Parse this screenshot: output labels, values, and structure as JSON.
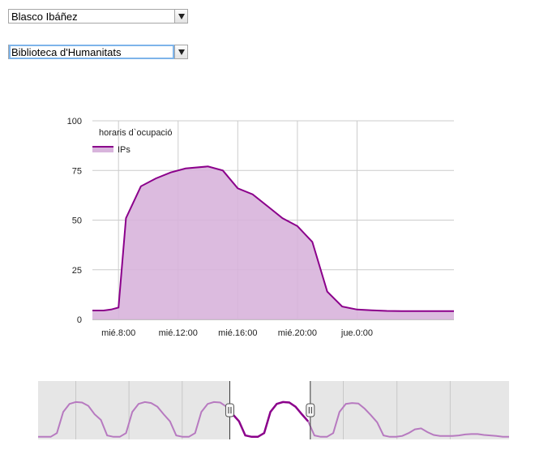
{
  "filters": {
    "campus": {
      "selected": "Blasco Ibáñez"
    },
    "library": {
      "selected": "Biblioteca d'Humanitats"
    }
  },
  "colors": {
    "series_line": "#8b008b",
    "series_fill": "#d8b4dc",
    "grid": "#cccccc",
    "navigator_bg": "#e6e6e6",
    "navigator_line": "#b77ac0"
  },
  "chart_data": {
    "type": "area",
    "legend_title": "horaris d`ocupació",
    "legend_position": "top-left",
    "grid": true,
    "ylim": [
      0,
      100
    ],
    "yticks": [
      "0",
      "25",
      "50",
      "75",
      "100"
    ],
    "xlim": [
      6.25,
      30.5
    ],
    "xticks": [
      {
        "label": "mié.8:00",
        "x": 8
      },
      {
        "label": "mié.12:00",
        "x": 12
      },
      {
        "label": "mié.16:00",
        "x": 16
      },
      {
        "label": "mié.20:00",
        "x": 20
      },
      {
        "label": "jue.0:00",
        "x": 24
      }
    ],
    "series": [
      {
        "name": "IPs",
        "x": [
          6.25,
          7,
          7.5,
          8,
          8.5,
          9.5,
          10.5,
          11.5,
          12.5,
          14,
          15,
          16,
          17,
          18,
          19,
          20,
          21,
          22,
          23,
          24,
          25,
          26,
          27,
          28,
          30.5
        ],
        "values": [
          4.5,
          4.5,
          5,
          6,
          51,
          67,
          71,
          74,
          76,
          77,
          75,
          66,
          63,
          57,
          51,
          47,
          39,
          14,
          6.5,
          5,
          4.6,
          4.3,
          4.2,
          4.2,
          4.2
        ]
      }
    ]
  },
  "navigator": {
    "range_start": 0.407,
    "range_end": 0.578,
    "values": [
      0.02,
      0.02,
      0.02,
      0.1,
      0.55,
      0.72,
      0.76,
      0.75,
      0.68,
      0.5,
      0.38,
      0.05,
      0.02,
      0.02,
      0.1,
      0.55,
      0.72,
      0.76,
      0.74,
      0.66,
      0.5,
      0.35,
      0.05,
      0.02,
      0.02,
      0.1,
      0.55,
      0.72,
      0.76,
      0.75,
      0.66,
      0.5,
      0.35,
      0.05,
      0.02,
      0.02,
      0.1,
      0.55,
      0.72,
      0.76,
      0.75,
      0.66,
      0.5,
      0.35,
      0.05,
      0.02,
      0.02,
      0.1,
      0.55,
      0.72,
      0.74,
      0.73,
      0.62,
      0.48,
      0.33,
      0.05,
      0.02,
      0.02,
      0.04,
      0.1,
      0.18,
      0.2,
      0.12,
      0.06,
      0.04,
      0.04,
      0.04,
      0.05,
      0.07,
      0.08,
      0.08,
      0.06,
      0.05,
      0.04,
      0.02,
      0.02
    ]
  }
}
